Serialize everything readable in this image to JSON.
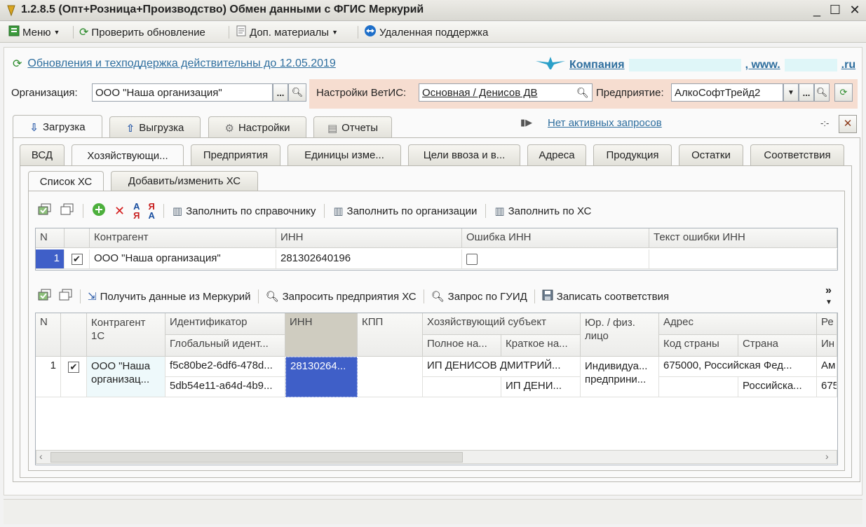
{
  "window": {
    "title": "1.2.8.5 (Опт+Розница+Производство) Обмен данными с ФГИС Меркурий",
    "min": "_",
    "max": "☐",
    "close": "✕"
  },
  "menubar": {
    "menu": "Меню",
    "check_update": "Проверить обновление",
    "extra": "Доп. материалы",
    "support": "Удаленная поддержка"
  },
  "info": {
    "updates_link": "Обновления и техподдержка действительны до 12.05.2019",
    "company_prefix": "Компания",
    "company_sep": ", www.",
    "company_suffix": ".ru"
  },
  "org": {
    "label": "Организация:",
    "value": "ООО \"Наша организация\"",
    "vetis_label": "Настройки ВетИС:",
    "vetis_value": "Основная / Денисов ДВ",
    "ent_label": "Предприятие:",
    "ent_value": "АлкоСофтТрейд2"
  },
  "main_tabs": [
    "Загрузка",
    "Выгрузка",
    "Настройки",
    "Отчеты"
  ],
  "requests_link": "Нет активных запросов",
  "sub_tabs": [
    "ВСД",
    "Хозяйствующи...",
    "Предприятия",
    "Единицы изме...",
    "Цели ввоза и в...",
    "Адреса",
    "Продукция",
    "Остатки",
    "Соответствия"
  ],
  "inner_tabs": [
    "Список ХС",
    "Добавить/изменить ХС"
  ],
  "toolbar1": {
    "fill_ref": "Заполнить по справочнику",
    "fill_org": "Заполнить по организации",
    "fill_hs": "Заполнить по ХС"
  },
  "grid1": {
    "headers": [
      "N",
      "",
      "Контрагент",
      "ИНН",
      "Ошибка ИНН",
      "Текст ошибки ИНН"
    ],
    "row": {
      "n": "1",
      "contractor": "ООО \"Наша организация\"",
      "inn": "281302640196"
    }
  },
  "toolbar2": {
    "get_data": "Получить данные из Меркурий",
    "request_ent": "Запросить предприятия ХС",
    "guid": "Запрос по ГУИД",
    "save": "Записать соответствия",
    "more": "»"
  },
  "grid2": {
    "h_n": "N",
    "h_contr1": "Контрагент",
    "h_contr2": "1С",
    "h_id": "Идентификатор",
    "h_gid": "Глобальный идент...",
    "h_inn": "ИНН",
    "h_kpp": "КПП",
    "h_hs": "Хозяйствующий субъект",
    "h_full": "Полное на...",
    "h_short": "Краткое на...",
    "h_jur1": "Юр. / физ.",
    "h_jur2": "лицо",
    "h_addr": "Адрес",
    "h_code": "Код страны",
    "h_country": "Страна",
    "h_re": "Ре",
    "h_in": "Ин",
    "row": {
      "n": "1",
      "contr1": "ООО \"Наша",
      "contr2": "организац...",
      "id": "f5c80be2-6df6-478d...",
      "gid": "5db54e11-a64d-4b9...",
      "inn": "28130264...",
      "full": "ИП ДЕНИСОВ ДМИТРИЙ...",
      "short": "ИП ДЕНИ...",
      "jur1": "Индивидуа...",
      "jur2": "предприни...",
      "addr": "675000, Российская Фед...",
      "country": "Российска...",
      "re": "Ам",
      "in": "675"
    }
  },
  "colors": {
    "selection": "#3f5fc8",
    "link": "#2e6e9e",
    "vetis_bg": "#f6ddd0"
  }
}
